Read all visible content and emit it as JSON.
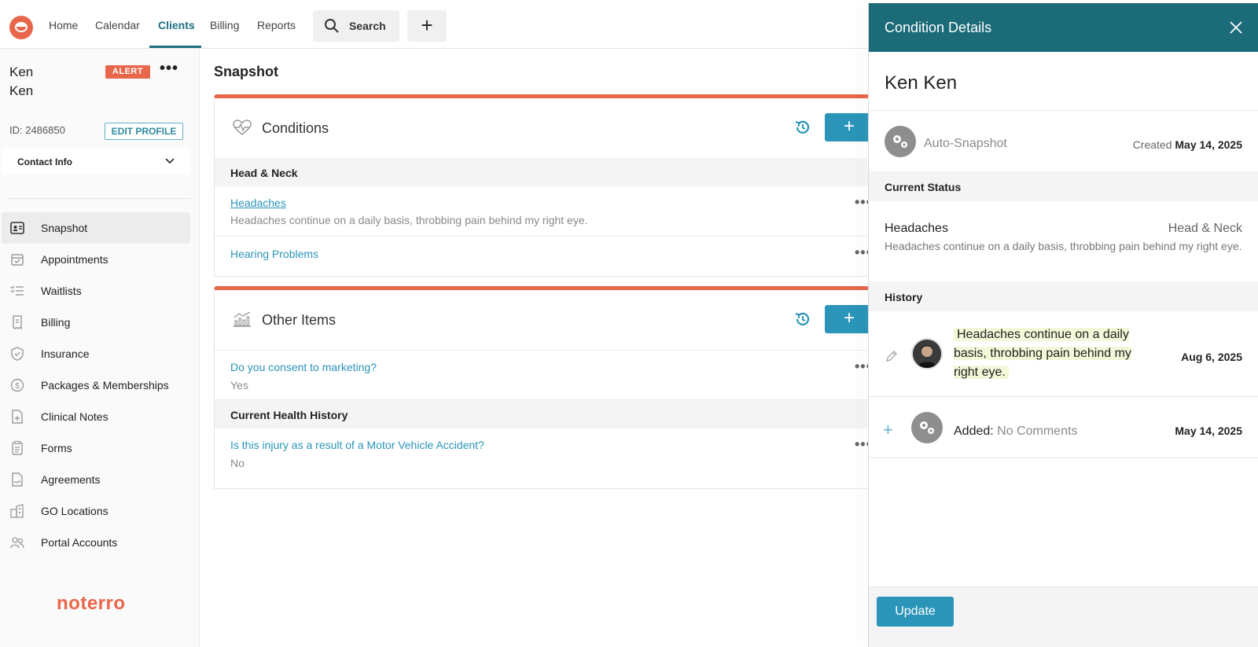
{
  "nav": {
    "links": [
      "Home",
      "Calendar",
      "Clients",
      "Billing",
      "Reports"
    ],
    "active": "Clients",
    "search_label": "Search",
    "add_label": "+"
  },
  "client": {
    "name": "Ken Ken",
    "first": "Ken",
    "last": "Ken",
    "alert": "ALERT",
    "more": "•••",
    "id": "ID: 2486850",
    "edit_profile": "EDIT PROFILE",
    "contact_info": "Contact Info"
  },
  "sidebar": {
    "items": [
      {
        "label": "Snapshot",
        "icon": "id-card-icon",
        "active": true
      },
      {
        "label": "Appointments",
        "icon": "calendar-check-icon"
      },
      {
        "label": "Waitlists",
        "icon": "checklist-icon"
      },
      {
        "label": "Billing",
        "icon": "receipt-icon"
      },
      {
        "label": "Insurance",
        "icon": "shield-check-icon"
      },
      {
        "label": "Packages & Memberships",
        "icon": "dollar-coin-icon"
      },
      {
        "label": "Clinical Notes",
        "icon": "note-plus-icon"
      },
      {
        "label": "Forms",
        "icon": "clipboard-icon"
      },
      {
        "label": "Agreements",
        "icon": "document-signed-icon"
      },
      {
        "label": "GO Locations",
        "icon": "buildings-icon"
      },
      {
        "label": "Portal Accounts",
        "icon": "users-icon"
      }
    ],
    "brand": "noterro"
  },
  "main": {
    "title": "Snapshot",
    "conditions": {
      "title": "Conditions",
      "add": "+",
      "section": "Head & Neck",
      "rows": [
        {
          "label": "Headaches",
          "desc": "Headaches continue on a daily basis, throbbing pain behind my right eye."
        },
        {
          "label": "Hearing Problems"
        }
      ]
    },
    "other": {
      "title": "Other Items",
      "add": "+",
      "rows": [
        {
          "label": "Do you consent to marketing?",
          "value": "Yes"
        }
      ],
      "section": "Current Health History",
      "rows2": [
        {
          "label": "Is this injury as a result of a Motor Vehicle Accident?",
          "value": "No"
        }
      ]
    },
    "more": "•••"
  },
  "panel": {
    "title": "Condition Details",
    "client_name": "Ken Ken",
    "source": "Auto-Snapshot",
    "created_label": "Created",
    "created_date": "May 14, 2025",
    "current_status_label": "Current Status",
    "condition": "Headaches",
    "category": "Head & Neck",
    "description": "Headaches continue on a daily basis, throbbing pain behind my right eye.",
    "history_label": "History",
    "history": [
      {
        "text": "Headaches continue on a daily basis, throbbing pain behind my right eye.",
        "date": "Aug 6, 2025"
      },
      {
        "label": "Added:",
        "text": "No Comments",
        "date": "May 14, 2025"
      }
    ],
    "update": "Update"
  },
  "colors": {
    "accent": "#e8664a",
    "teal": "#1b6b78",
    "link": "#2a95b8"
  }
}
